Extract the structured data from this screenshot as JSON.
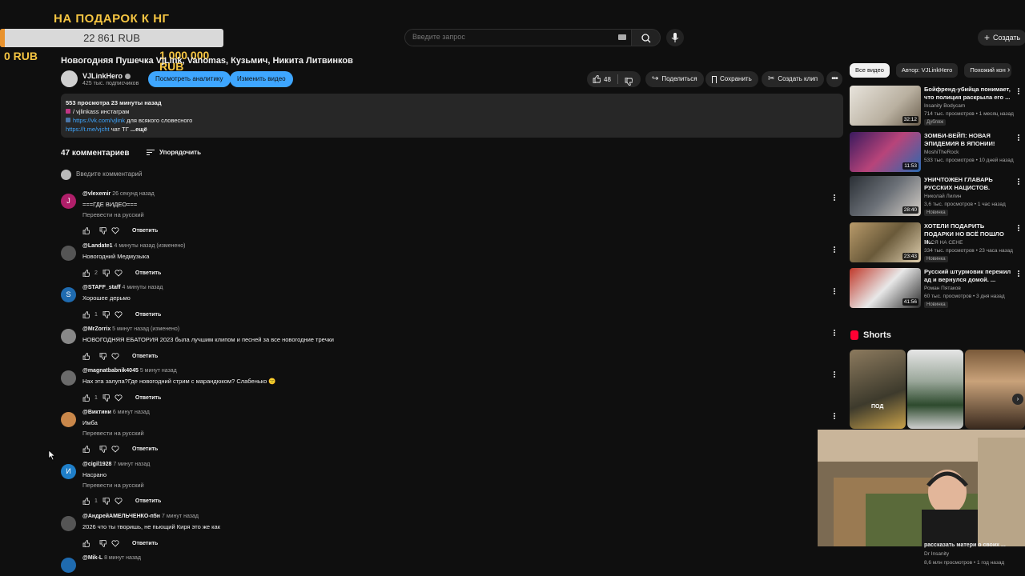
{
  "donation": {
    "title": "НА ПОДАРОК К НГ",
    "amount": "22 861 RUB",
    "min": "0 RUB",
    "max": "1 000 000 RUB",
    "progress_fraction": 0.0229,
    "color": "#e8922d"
  },
  "topbar": {
    "search_placeholder": "Введите запрос",
    "create_label": "Создать"
  },
  "video": {
    "title": "Новогодняя Пушечка VjLink, Vanomas, Кузьмич, Никита Литвинков",
    "channel": "VJLinkHero",
    "subscribers": "425 тыс. подписчиков",
    "analytics_button": "Посмотреть аналитику",
    "edit_button": "Изменить видео",
    "likes": "48",
    "share": "Поделиться",
    "save": "Сохранить",
    "clip": "Создать клип"
  },
  "description": {
    "meta": "553 просмотра  23 минуты назад",
    "line1": "/ vjlinkass  инстаграм",
    "line2_link": "https://vk.com/vjlink",
    "line2_text": " для всякого словесного",
    "line3_link": "https://t.me/vjcht",
    "line3_text": " чат ТГ ",
    "more": "...ещё"
  },
  "comments_header": {
    "count": "47 комментариев",
    "sort": "Упорядочить",
    "add_placeholder": "Введите комментарий"
  },
  "comments": [
    {
      "author": "@vlexemir",
      "time": "26 секунд назад",
      "text": "===ГДЕ ВИДЕО===",
      "translate": "Перевести на русский",
      "likes": "",
      "avatar_letter": "J",
      "avatar_color": "#b01f6a",
      "reply": "Ответить"
    },
    {
      "author": "@Landate1",
      "time": "4 минуты назад (изменено)",
      "text": "Новогодний Медмузыка",
      "translate": "",
      "likes": "2",
      "avatar_letter": "",
      "avatar_color": "#555555",
      "reply": "Ответить"
    },
    {
      "author": "@STAFF_staff",
      "time": "4 минуты назад",
      "text": "Хорошее дерьмо",
      "translate": "",
      "likes": "1",
      "avatar_letter": "S",
      "avatar_color": "#1f6bb0",
      "reply": "Ответить"
    },
    {
      "author": "@MrZorrix",
      "time": "5 минут назад (изменено)",
      "text": "НОВОГОДНЯЯ ЕБАТОРИЯ 2023 была лучшим клипом и песней за все новогодние тречки",
      "translate": "",
      "likes": "",
      "avatar_letter": "",
      "avatar_color": "#888888",
      "reply": "Ответить"
    },
    {
      "author": "@magnatbabnik4045",
      "time": "5 минут назад",
      "text": "Нах эта залупа?Где новогодний  стрим с марандюком? Слабенько 😕",
      "translate": "",
      "likes": "1",
      "avatar_letter": "",
      "avatar_color": "#6b6b6b",
      "reply": "Ответить"
    },
    {
      "author": "@Виктини",
      "time": "6 минут назад",
      "text": "Имба",
      "translate": "Перевести на русский",
      "likes": "",
      "avatar_letter": "",
      "avatar_color": "#c9874a",
      "reply": "Ответить"
    },
    {
      "author": "@cigil1928",
      "time": "7 минут назад",
      "text": "Насрано",
      "translate": "Перевести на русский",
      "likes": "1",
      "avatar_letter": "И",
      "avatar_color": "#1f7fc9",
      "reply": "Ответить"
    },
    {
      "author": "@АндрейАМЕЛЬЧЕНКО-п5н",
      "time": "7 минут назад",
      "text": "2026 что ты творишь, не пьющий Киря это же как",
      "translate": "",
      "likes": "",
      "avatar_letter": "",
      "avatar_color": "#555555",
      "reply": "Ответить"
    },
    {
      "author": "@Mik-L",
      "time": "8 минут назад",
      "text": "",
      "translate": "",
      "likes": "",
      "avatar_letter": "",
      "avatar_color": "#1f6bb0",
      "reply": ""
    }
  ],
  "sidebar": {
    "chips": [
      "Все видео",
      "Автор: VJLinkHero",
      "Похожий кон"
    ],
    "recommendations": [
      {
        "title": "Бойфренд-убийца понимает, что полиция раскрыла его ...",
        "channel": "Insanity Bodycam",
        "stats": "714 тыс. просмотров • 1 месяц назад",
        "badge": "Дубляж",
        "duration": "32:12"
      },
      {
        "title": "ЗОМБИ-ВЕЙП: НОВАЯ ЭПИДЕМИЯ В ЯПОНИИ!",
        "channel": "MoshiTheRock",
        "stats": "533 тыс. просмотров • 10 дней назад",
        "badge": "",
        "duration": "11:53"
      },
      {
        "title": "УНИЧТОЖЕН ГЛАВАРЬ РУССКИХ НАЦИСТОВ.",
        "channel": "Николай Лилин",
        "stats": "3,6 тыс. просмотров • 1 час назад",
        "badge": "Новинка",
        "duration": "28:40"
      },
      {
        "title": "ХОТЕЛИ ПОДАРИТЬ ПОДАРКИ НО ВСЁ ПОШЛО Н...",
        "channel": "ВАСЯ НА СЕНЕ",
        "stats": "334 тыс. просмотров • 23 часа назад",
        "badge": "Новинка",
        "duration": "23:43"
      },
      {
        "title": "Русский штурмовик пережил ад и вернулся домой. ...",
        "channel": "Роман Пятаков",
        "stats": "60 тыс. просмотров • 3 дня назад",
        "badge": "Новинка",
        "duration": "41:56"
      }
    ],
    "shorts_title": "Shorts",
    "short_label": "ПОД",
    "bottom_title": "рассказать матери о своих ...",
    "bottom_channel": "Dr Insanity",
    "bottom_stats": "8,6 млн просмотров • 1 год назад"
  }
}
